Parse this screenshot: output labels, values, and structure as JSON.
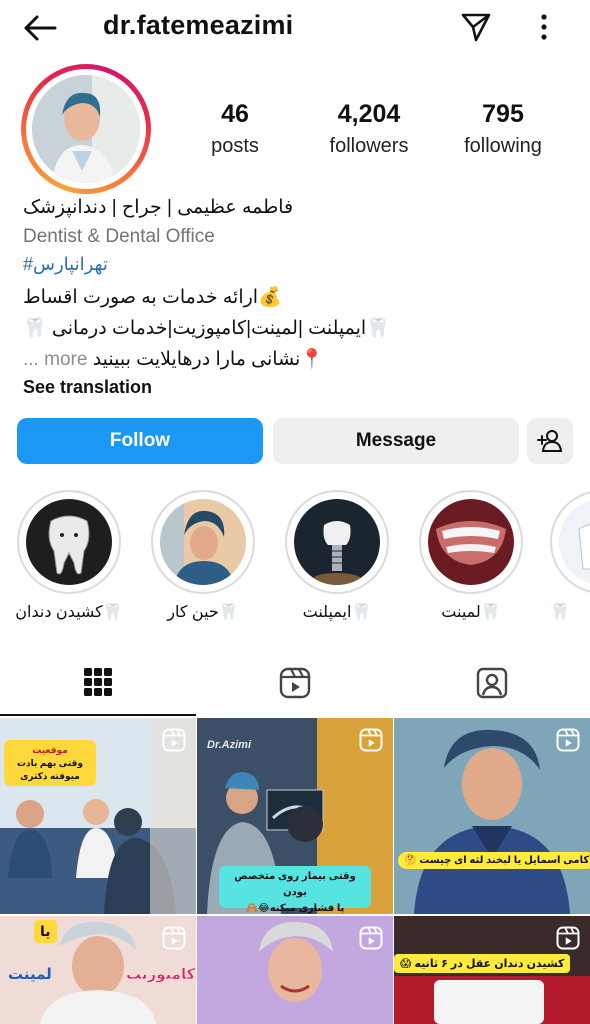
{
  "header": {
    "username": "dr.fatemeazimi",
    "back_icon": "arrow-left-icon",
    "send_icon": "paper-plane-icon",
    "more_icon": "more-vertical-icon"
  },
  "stats": {
    "posts": {
      "value": "46",
      "label": "posts"
    },
    "followers": {
      "value": "4,204",
      "label": "followers"
    },
    "following": {
      "value": "795",
      "label": "following"
    }
  },
  "bio": {
    "name": "فاطمه عظیمی | جراح | دندانپزشک",
    "category": "Dentist & Dental Office",
    "hashtag": "#تهرانپارس",
    "line1": "💰ارائه خدمات به صورت اقساط",
    "line2": "🦷ایمپلنت |لمینت|کامپوزیت|خدمات درمانی 🦷",
    "line3": "📍نشانی مارا درهایلایت ببینید",
    "more": "... more",
    "translate": "See translation"
  },
  "actions": {
    "follow": "Follow",
    "message": "Message",
    "add_user_icon": "add-user-icon"
  },
  "highlights": [
    {
      "label": "🦷کشیدن دندان"
    },
    {
      "label": "🦷حین کار"
    },
    {
      "label": "🦷ایمپلنت"
    },
    {
      "label": "🦷لمینت"
    },
    {
      "label": "🦷"
    }
  ],
  "tabs": [
    {
      "name": "grid-icon"
    },
    {
      "name": "reels-icon"
    },
    {
      "name": "tagged-icon"
    }
  ],
  "posts": {
    "p1_caption_a": "موقعیت",
    "p1_caption_b": "وقتی بهم بادت میوفته دکتری",
    "p2_caption_a": "وقتی بیمار روی متخصص بودن",
    "p2_caption_b": "پا فشاری میکنه😂🙈",
    "p2_logo": "Dr.Azimi",
    "p3_caption": "کامی اسمایل یا لبخند لثه ای چیست 🤔",
    "p4_caption_a": "کامپوزیت",
    "p4_caption_b": "یا",
    "p4_caption_c": "لمینت",
    "p6_caption": "کشیدن دندان عقل در ۶ ثانیه 😱"
  },
  "colors": {
    "accent": "#1a98f3",
    "ring_start": "#f9a23a",
    "ring_end": "#d3156f"
  }
}
